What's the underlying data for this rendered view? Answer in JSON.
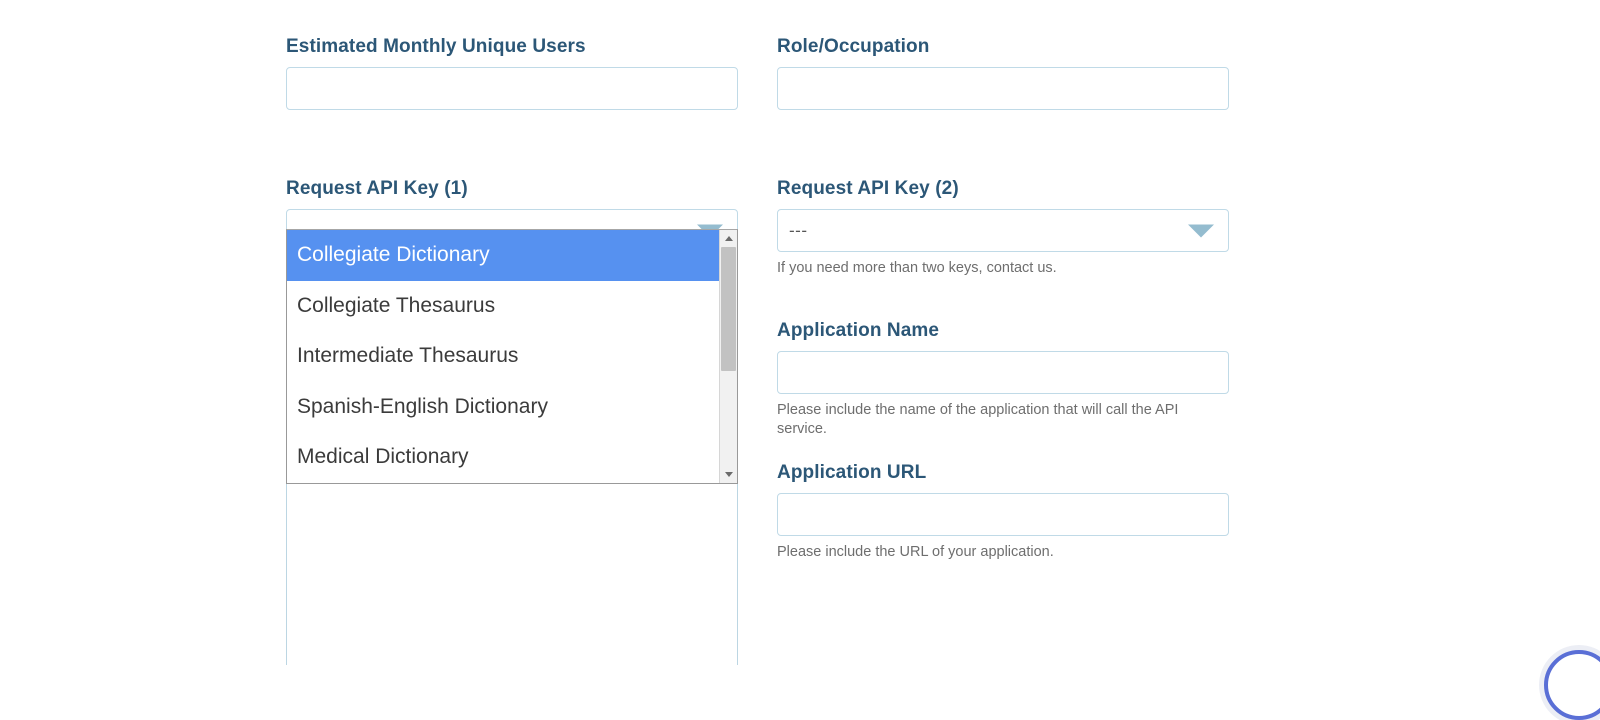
{
  "form": {
    "fields": [
      {
        "id": "estimated-monthly-unique-users",
        "label": "Estimated Monthly Unique Users",
        "value": "",
        "placeholder": ""
      },
      {
        "id": "role-occupation",
        "label": "Role/Occupation",
        "value": "",
        "placeholder": ""
      },
      {
        "id": "application-name",
        "label": "Application Name",
        "value": "",
        "placeholder": "",
        "help": "Please include the name of the application that will call the API service."
      },
      {
        "id": "application-url",
        "label": "Application URL",
        "value": "",
        "placeholder": "",
        "help": "Please include the URL of your application."
      }
    ],
    "api_key_1": {
      "label": "Request API Key (1)",
      "value": "---",
      "expanded": true,
      "arrow_icon": "chevron-down-icon",
      "options": [
        "Collegiate Dictionary",
        "Collegiate Thesaurus",
        "Intermediate Thesaurus",
        "Spanish-English Dictionary",
        "Medical Dictionary"
      ],
      "selected_option": "Collegiate Dictionary",
      "scrollbar": {
        "up_icon": "scroll-up-arrow-icon",
        "down_icon": "scroll-down-arrow-icon"
      }
    },
    "api_key_2": {
      "label": "Request API Key (2)",
      "value": "---",
      "expanded": false,
      "arrow_icon": "chevron-down-icon",
      "help_prefix": "If you need more than two keys, ",
      "help_link": "contact us",
      "help_suffix": "."
    }
  },
  "widgets": {
    "chat_launcher": "chat-launcher-icon"
  },
  "colors": {
    "label": "#2c5777",
    "input_border": "#c0dae7",
    "select_arrow": "#94bccf",
    "option_highlight": "#5691f0",
    "help_text": "#6e6e6e",
    "chat_accent": "#5a6fd6"
  }
}
